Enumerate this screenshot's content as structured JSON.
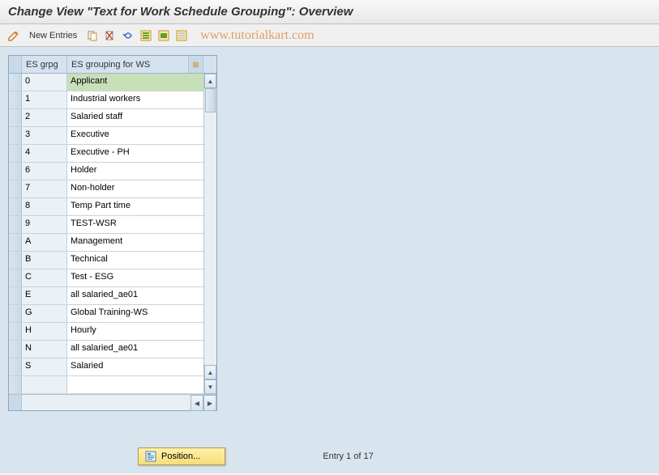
{
  "title": "Change View \"Text for Work Schedule Grouping\": Overview",
  "toolbar": {
    "new_entries": "New Entries"
  },
  "watermark": "www.tutorialkart.com",
  "columns": {
    "grpg": "ES grpg",
    "desc": "ES grouping for WS"
  },
  "rows": [
    {
      "grpg": "0",
      "desc": "Applicant",
      "selected": true
    },
    {
      "grpg": "1",
      "desc": "Industrial workers"
    },
    {
      "grpg": "2",
      "desc": "Salaried staff"
    },
    {
      "grpg": "3",
      "desc": "Executive"
    },
    {
      "grpg": "4",
      "desc": "Executive - PH"
    },
    {
      "grpg": "6",
      "desc": "Holder"
    },
    {
      "grpg": "7",
      "desc": "Non-holder"
    },
    {
      "grpg": "8",
      "desc": "Temp Part time"
    },
    {
      "grpg": "9",
      "desc": "TEST-WSR"
    },
    {
      "grpg": "A",
      "desc": "Management"
    },
    {
      "grpg": "B",
      "desc": "Technical"
    },
    {
      "grpg": "C",
      "desc": "Test - ESG"
    },
    {
      "grpg": "E",
      "desc": "all salaried_ae01"
    },
    {
      "grpg": "G",
      "desc": "Global Training-WS"
    },
    {
      "grpg": "H",
      "desc": "Hourly"
    },
    {
      "grpg": "N",
      "desc": "all salaried_ae01"
    },
    {
      "grpg": "S",
      "desc": "Salaried"
    }
  ],
  "footer": {
    "position_btn": "Position...",
    "entry_status": "Entry 1 of 17"
  }
}
